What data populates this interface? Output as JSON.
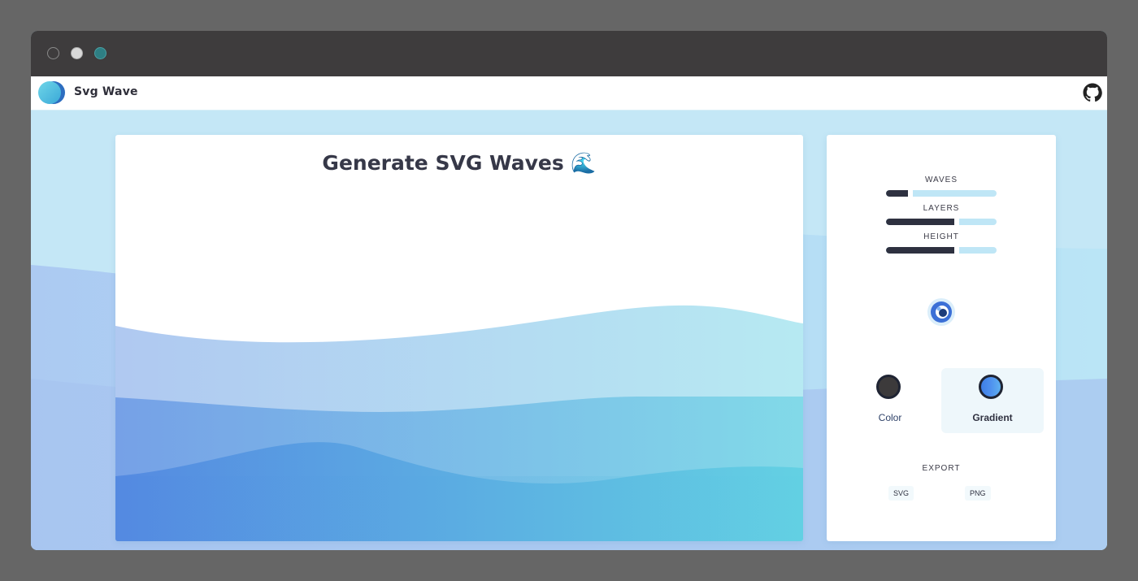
{
  "window": {
    "controls": [
      "close-dot",
      "minimize-dot",
      "maximize-dot"
    ]
  },
  "navbar": {
    "brand": "Svg Wave",
    "github_icon": "github-icon"
  },
  "preview": {
    "headline": "Generate SVG Waves 🌊"
  },
  "controls": {
    "sliders": [
      {
        "label": "WAVES",
        "value_fraction": 0.2
      },
      {
        "label": "LAYERS",
        "value_fraction": 0.62
      },
      {
        "label": "HEIGHT",
        "value_fraction": 0.62
      }
    ],
    "randomize_icon": "dice-icon",
    "modes": [
      {
        "label": "Color",
        "selected": false
      },
      {
        "label": "Gradient",
        "selected": true
      }
    ],
    "export": {
      "label": "EXPORT",
      "svg_label": "SVG",
      "png_label": "PNG"
    }
  },
  "colors": {
    "page_bg": "#666666",
    "titlebar": "#3e3c3d",
    "gradient_start": "#4f86e0",
    "gradient_end": "#5ecfe2",
    "slider_track": "#bfe6f6",
    "slider_fill": "#2e3140"
  }
}
